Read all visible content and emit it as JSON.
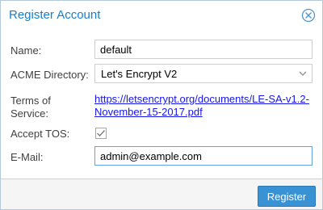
{
  "dialog": {
    "title": "Register Account",
    "close_icon": "close-circle-icon"
  },
  "form": {
    "name_label": "Name:",
    "name_value": "default",
    "acme_directory_label": "ACME Directory:",
    "acme_directory_value": "Let's Encrypt V2",
    "acme_directory_trigger_icon": "chevron-down-icon",
    "tos_label_line1": "Terms of",
    "tos_label_line2": "Service:",
    "tos_link": "https://letsencrypt.org/documents/LE-SA-v1.2-November-15-2017.pdf",
    "accept_tos_label": "Accept TOS:",
    "accept_tos_checked": true,
    "email_label": "E-Mail:",
    "email_value": "admin@example.com"
  },
  "footer": {
    "register_label": "Register"
  },
  "colors": {
    "accent": "#157fcc",
    "button": "#3892d3",
    "link": "#1515ee"
  }
}
